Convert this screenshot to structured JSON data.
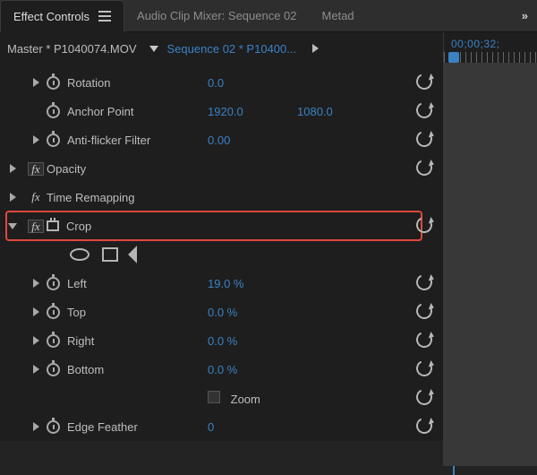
{
  "tabs": {
    "effect_controls": "Effect Controls",
    "audio_mixer": "Audio Clip Mixer: Sequence 02",
    "metadata": "Metad",
    "overflow": "»"
  },
  "header": {
    "master": "Master * P1040074.MOV",
    "sequence": "Sequence 02 * P10400...",
    "timecode": "00;00;32;"
  },
  "props": {
    "rotation": {
      "label": "Rotation",
      "value": "0.0"
    },
    "anchor": {
      "label": "Anchor Point",
      "x": "1920.0",
      "y": "1080.0"
    },
    "antiflicker": {
      "label": "Anti-flicker Filter",
      "value": "0.00"
    },
    "opacity": {
      "label": "Opacity"
    },
    "timeremap": {
      "label": "Time Remapping"
    },
    "crop": {
      "label": "Crop",
      "left_label": "Left",
      "left": "19.0 %",
      "top_label": "Top",
      "top": "0.0 %",
      "right_label": "Right",
      "right": "0.0 %",
      "bottom_label": "Bottom",
      "bottom": "0.0 %",
      "zoom_label": "Zoom",
      "edge_label": "Edge Feather",
      "edge": "0"
    }
  }
}
